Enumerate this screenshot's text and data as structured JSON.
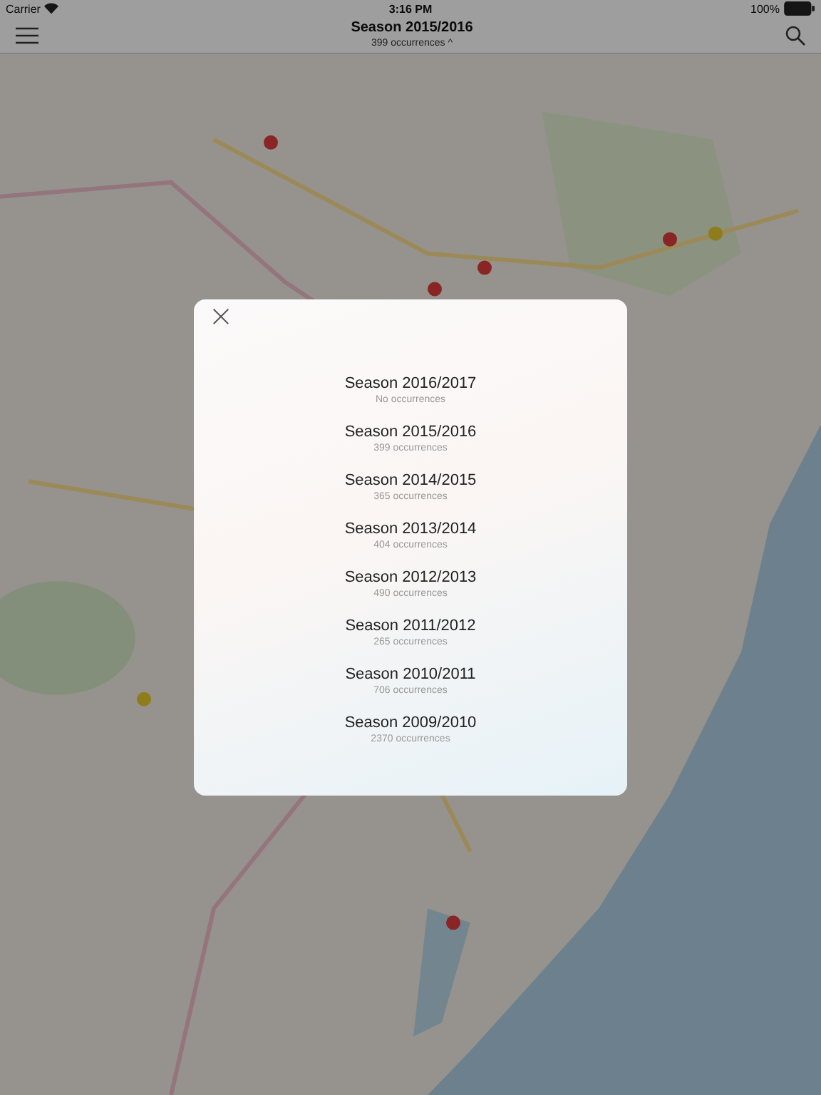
{
  "status_bar": {
    "carrier": "Carrier",
    "time": "3:16 PM",
    "battery": "100%"
  },
  "nav_bar": {
    "title": "Season 2015/2016",
    "subtitle": "399 occurrences ^"
  },
  "season_picker": {
    "seasons": [
      {
        "title": "Season 2016/2017",
        "count": "No occurrences"
      },
      {
        "title": "Season 2015/2016",
        "count": "399 occurrences"
      },
      {
        "title": "Season 2014/2015",
        "count": "365 occurrences"
      },
      {
        "title": "Season 2013/2014",
        "count": "404 occurrences"
      },
      {
        "title": "Season 2012/2013",
        "count": "490 occurrences"
      },
      {
        "title": "Season 2011/2012",
        "count": "265 occurrences"
      },
      {
        "title": "Season 2010/2011",
        "count": "706 occurrences"
      },
      {
        "title": "Season 2009/2010",
        "count": "2370 occurrences"
      }
    ]
  }
}
